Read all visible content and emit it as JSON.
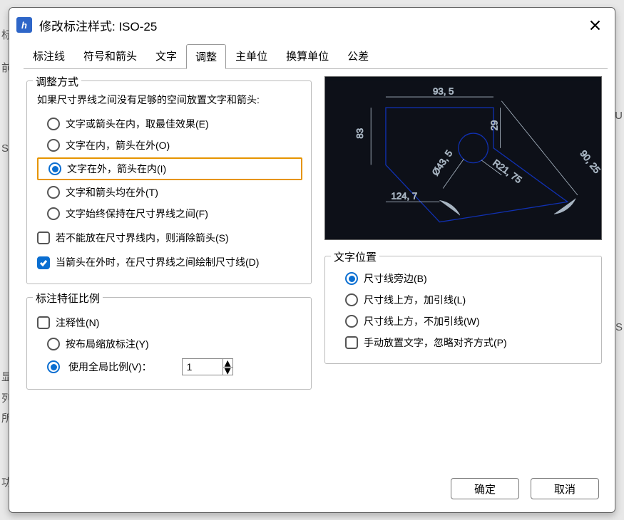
{
  "window": {
    "title": "修改标注样式: ISO-25"
  },
  "tabs": [
    "标注线",
    "符号和箭头",
    "文字",
    "调整",
    "主单位",
    "换算单位",
    "公差"
  ],
  "active_tab": 3,
  "fit": {
    "group_title": "调整方式",
    "desc": "如果尺寸界线之间没有足够的空间放置文字和箭头:",
    "options": [
      "文字或箭头在内，取最佳效果(E)",
      "文字在内，箭头在外(O)",
      "文字在外，箭头在内(I)",
      "文字和箭头均在外(T)",
      "文字始终保持在尺寸界线之间(F)"
    ],
    "selected": 2,
    "suppress_arrows": "若不能放在尺寸界线内，则消除箭头(S)",
    "draw_dim_line": "当箭头在外时，在尺寸界线之间绘制尺寸线(D)",
    "draw_dim_line_checked": true
  },
  "scale": {
    "group_title": "标注特征比例",
    "annotative": "注释性(N)",
    "layout_scale": "按布局缩放标注(Y)",
    "global_scale": "使用全局比例(V)：",
    "global_selected": true,
    "global_value": "1"
  },
  "text_pos": {
    "group_title": "文字位置",
    "options": [
      "尺寸线旁边(B)",
      "尺寸线上方，加引线(L)",
      "尺寸线上方，不加引线(W)"
    ],
    "selected": 0,
    "manual_place": "手动放置文字，忽略对齐方式(P)"
  },
  "preview": {
    "dims": {
      "top": "93, 5",
      "left": "83",
      "inner_v": "29",
      "diag": "Ø43, 5",
      "radius": "R21, 75",
      "right": "90, 25",
      "bottom": "124, 7"
    }
  },
  "buttons": {
    "ok": "确定",
    "cancel": "取消"
  },
  "side_letters": {
    "k": "标",
    "q": "前",
    "s": "S",
    "x": "显",
    "l": "列",
    "h": "所",
    "g": "功",
    "u": "(U"
  }
}
